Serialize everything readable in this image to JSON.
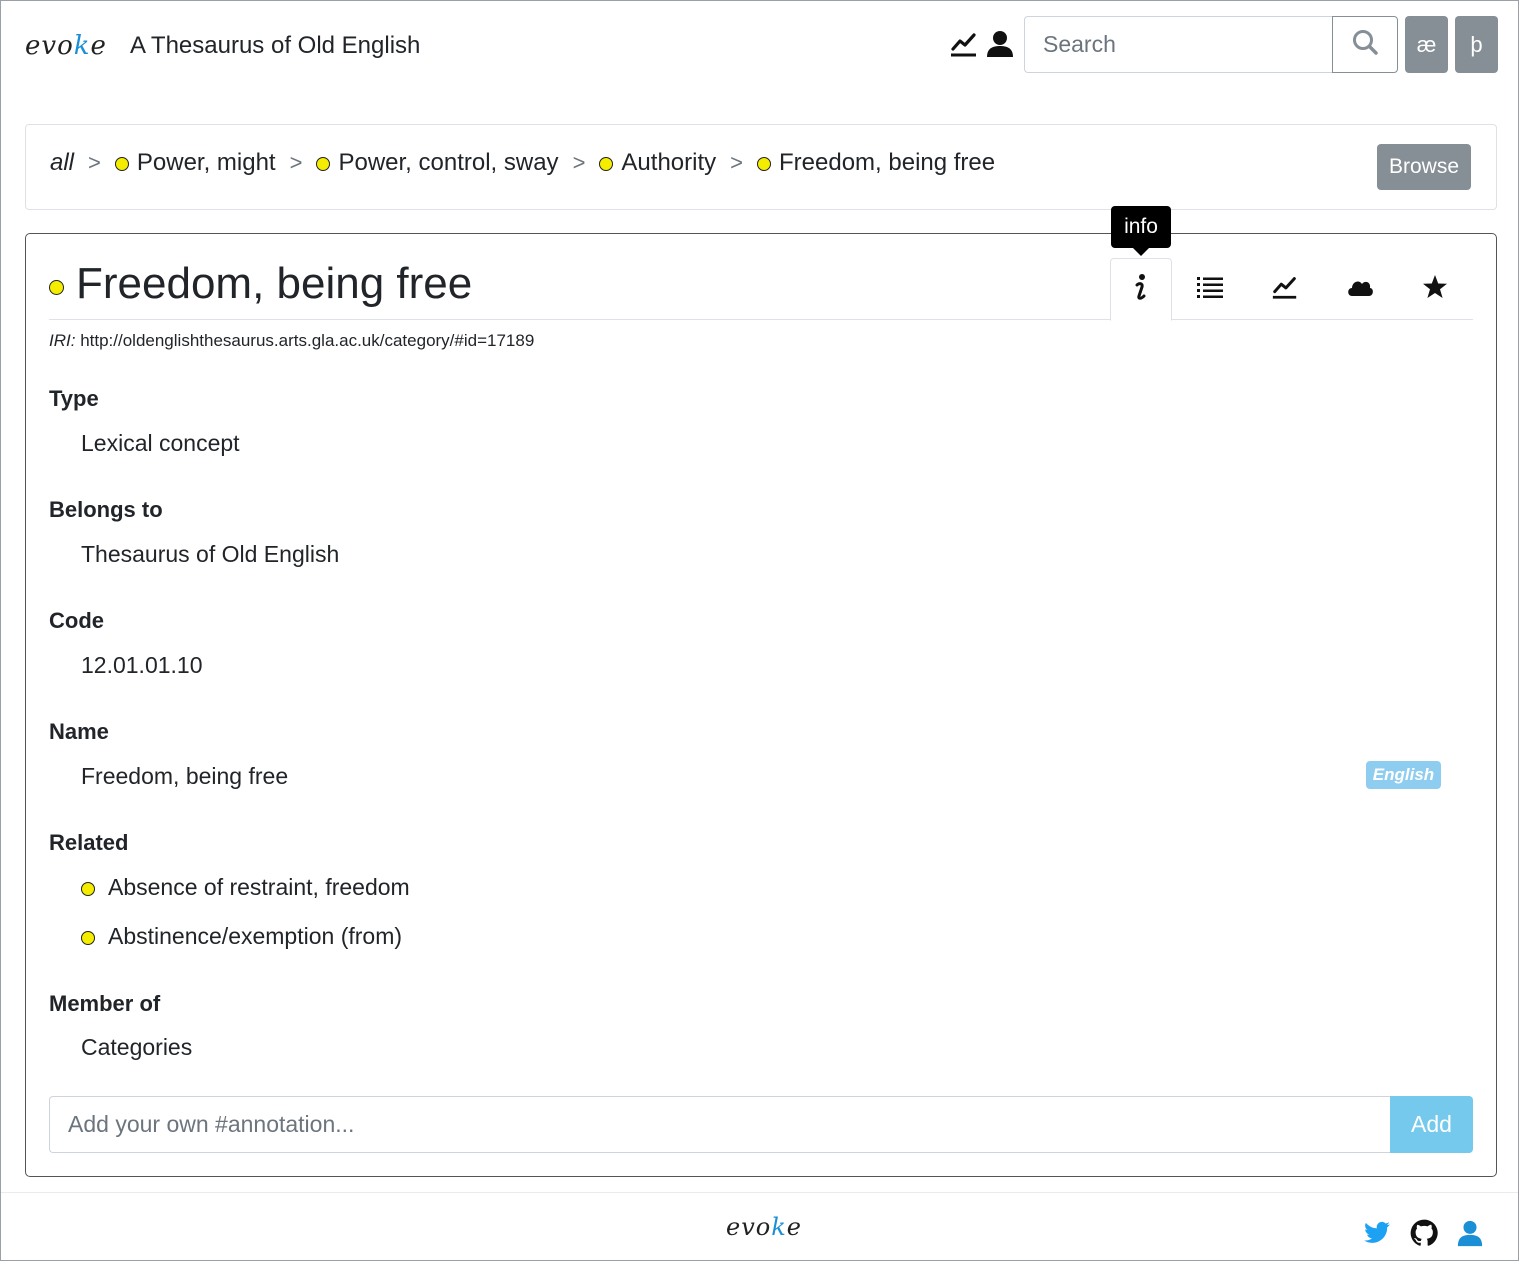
{
  "header": {
    "logo_text_a": "evo",
    "logo_text_k": "k",
    "logo_text_b": "e",
    "title": "A Thesaurus of Old English",
    "search_placeholder": "Search",
    "char_buttons": [
      "æ",
      "þ"
    ],
    "icons": [
      "chart-line-icon",
      "user-icon",
      "search-icon"
    ]
  },
  "breadcrumb": {
    "root": "all",
    "separator": ">",
    "items": [
      "Power, might",
      "Power, control, sway",
      "Authority",
      "Freedom, being free"
    ],
    "browse_label": "Browse"
  },
  "concept": {
    "title": "Freedom, being free",
    "iri_label": "IRI:",
    "iri_value": "http://oldenglishthesaurus.arts.gla.ac.uk/category/#id=17189",
    "tooltip": "info",
    "tabs": [
      "info-icon",
      "list-icon",
      "chart-line-icon",
      "cloud-icon",
      "star-icon"
    ],
    "fields": {
      "type_label": "Type",
      "type_value": "Lexical concept",
      "belongs_label": "Belongs to",
      "belongs_value": "Thesaurus of Old English",
      "code_label": "Code",
      "code_value": "12.01.01.10",
      "name_label": "Name",
      "name_value": "Freedom, being free",
      "name_lang": "English",
      "related_label": "Related",
      "related_items": [
        "Absence of restraint, freedom",
        "Abstinence/exemption (from)"
      ],
      "member_label": "Member of",
      "member_value": "Categories"
    },
    "annotation_placeholder": "Add your own #annotation...",
    "add_label": "Add"
  },
  "footer": {
    "logo_text_a": "evo",
    "logo_text_k": "k",
    "logo_text_b": "e",
    "icons": [
      "twitter-icon",
      "github-icon",
      "user-icon"
    ]
  },
  "colors": {
    "concept_dot": "#f5ed00",
    "secondary_button": "#868e96",
    "info_button": "#75c9ec",
    "badge": "#8fcdf0",
    "link_blue": "#1a8fd6"
  }
}
